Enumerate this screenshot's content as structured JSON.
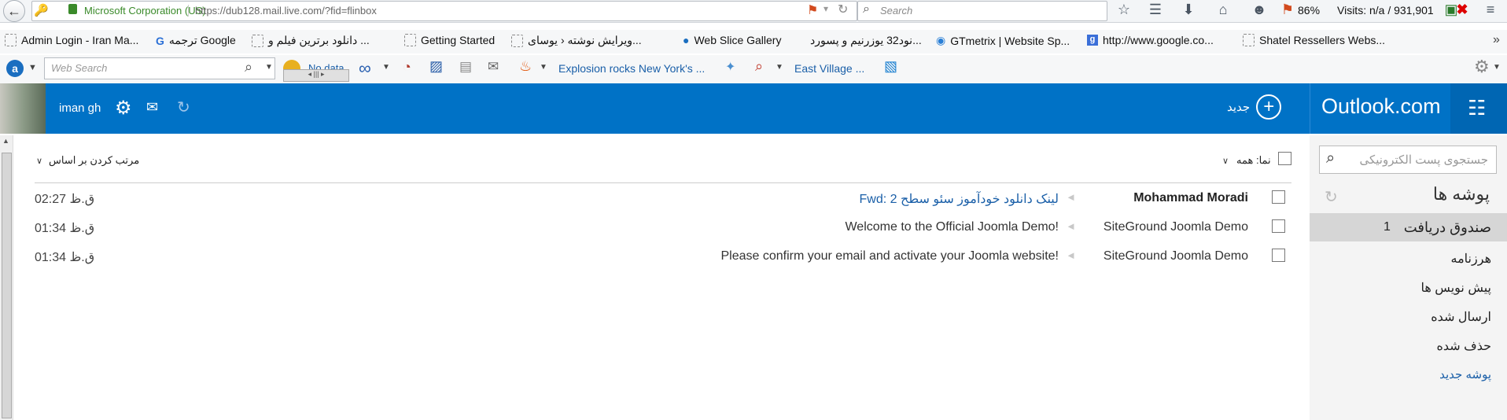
{
  "browser": {
    "identity": "Microsoft Corporation (US)",
    "url": "https://dub128.mail.live.com/?fid=flinbox",
    "search_placeholder": "Search",
    "zoom": "86%",
    "visits": "Visits: n/a / 931,901"
  },
  "bookmarks": [
    "Admin Login - Iran Ma...",
    "ترجمه Google",
    "دانلود برترین فیلم و ...",
    "Getting Started",
    "ویرایش نوشته ‹ یوسای...",
    "Web Slice Gallery",
    "نود32 یوزرنیم و پسورد...",
    "GTmetrix | Website Sp...",
    "http://www.google.co...",
    "Shatel Ressellers Webs..."
  ],
  "addon_toolbar": {
    "web_search_placeholder": "Web Search",
    "no_data": "No data",
    "news_1": "Explosion rocks New York's ...",
    "news_2": "East Village ..."
  },
  "outlook": {
    "user_name": "iman gh",
    "new_label": "جدید",
    "brand": "Outlook.com",
    "sort_label": "مرتب کردن بر اساس",
    "view_label": "نما: همه",
    "search_placeholder": "جستجوی پست الکترونیکی",
    "folders_title": "پوشه ها",
    "inbox_label": "صندوق دریافت",
    "inbox_count": "1",
    "folders": [
      "هرزنامه",
      "پیش نویس ها",
      "ارسال شده",
      "حذف شده"
    ],
    "new_folder": "پوشه جدید",
    "messages": [
      {
        "sender": "Mohammad Moradi",
        "subject": "Fwd: لینک دانلود خودآموز سئو سطح 2",
        "time": "02:27 ق.ظ"
      },
      {
        "sender": "SiteGround Joomla Demo",
        "subject": "Welcome to the Official Joomla Demo!",
        "time": "01:34 ق.ظ"
      },
      {
        "sender": "SiteGround Joomla Demo",
        "subject": "Please confirm your email and activate your Joomla website!",
        "time": "01:34 ق.ظ"
      }
    ]
  },
  "colors": {
    "outlook_blue": "#0072c6",
    "link_blue": "#1a5fa8",
    "lock_green": "#3a8a2a"
  }
}
